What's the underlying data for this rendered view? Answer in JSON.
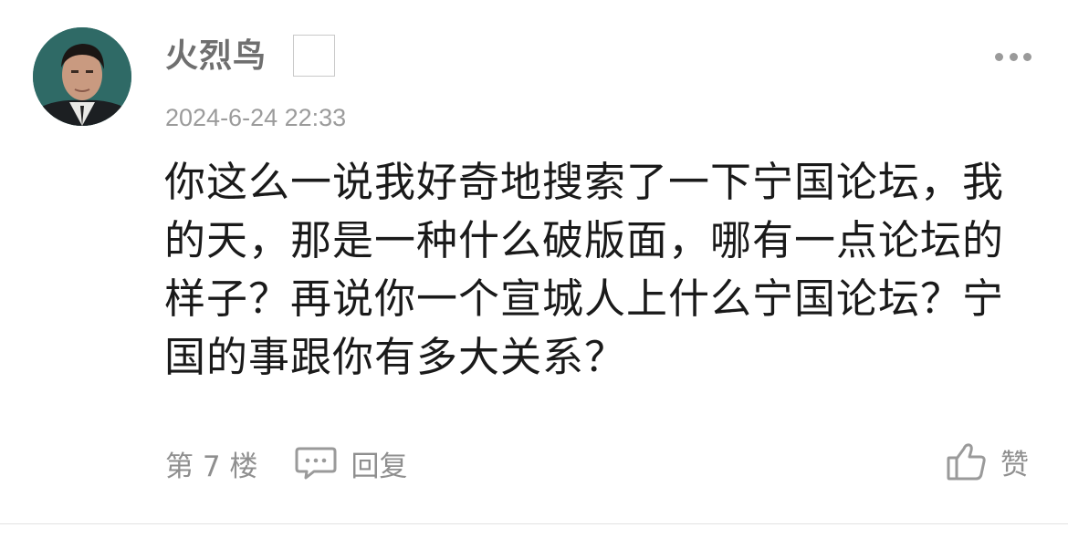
{
  "comment": {
    "username": "火烈鸟",
    "timestamp": "2024-6-24 22:33",
    "text": "你这么一说我好奇地搜索了一下宁国论坛，我的天，那是一种什么破版面，哪有一点论坛的样子？再说你一个宣城人上什么宁国论坛？宁国的事跟你有多大关系？",
    "floor": "第 7 楼",
    "reply_label": "回复",
    "like_label": "赞"
  },
  "icons": {
    "more": "more-dots-icon",
    "reply": "comment-bubble-icon",
    "like": "thumbs-up-icon"
  },
  "colors": {
    "text": "#1a1a1a",
    "meta": "#9b9b9b",
    "username": "#6f6f6f",
    "divider": "#e3e3e3"
  }
}
